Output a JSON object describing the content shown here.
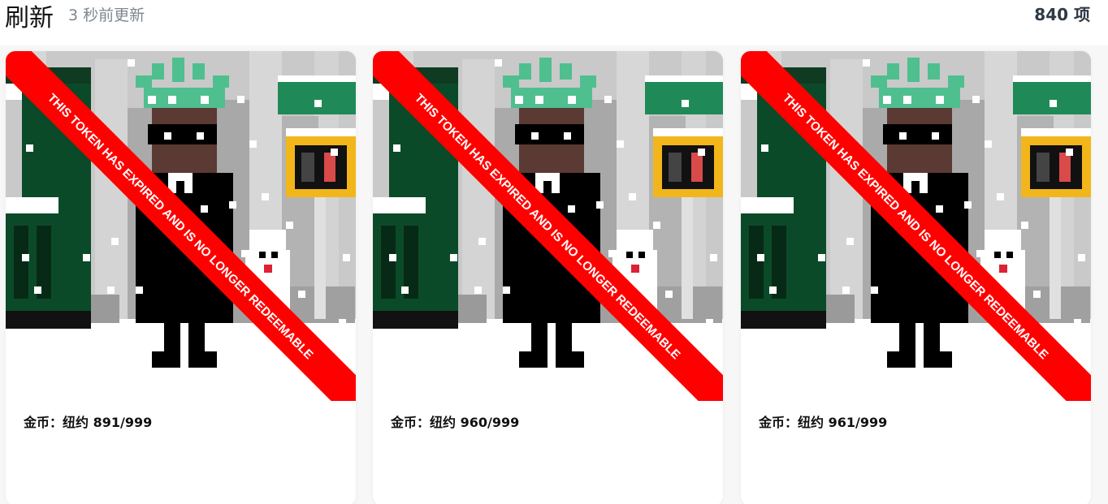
{
  "header": {
    "refresh_label": "刷新",
    "updated_text": "3 秒前更新",
    "item_count": "840 项"
  },
  "cards": [
    {
      "title": "金币：纽约 891/999",
      "banner": "THIS TOKEN HAS EXPIRED AND IS NO LONGER REDEEMABLE"
    },
    {
      "title": "金币：纽约 960/999",
      "banner": "THIS TOKEN HAS EXPIRED AND IS NO LONGER REDEEMABLE"
    },
    {
      "title": "金币：纽约 961/999",
      "banner": "THIS TOKEN HAS EXPIRED AND IS NO LONGER REDEEMABLE"
    }
  ],
  "colors": {
    "banner_red": "#ff0000",
    "crown_green": "#4fbf8f",
    "sign_yellow": "#f2b61b",
    "awning_green": "#1f8a57",
    "dark_green": "#0f3b22"
  }
}
